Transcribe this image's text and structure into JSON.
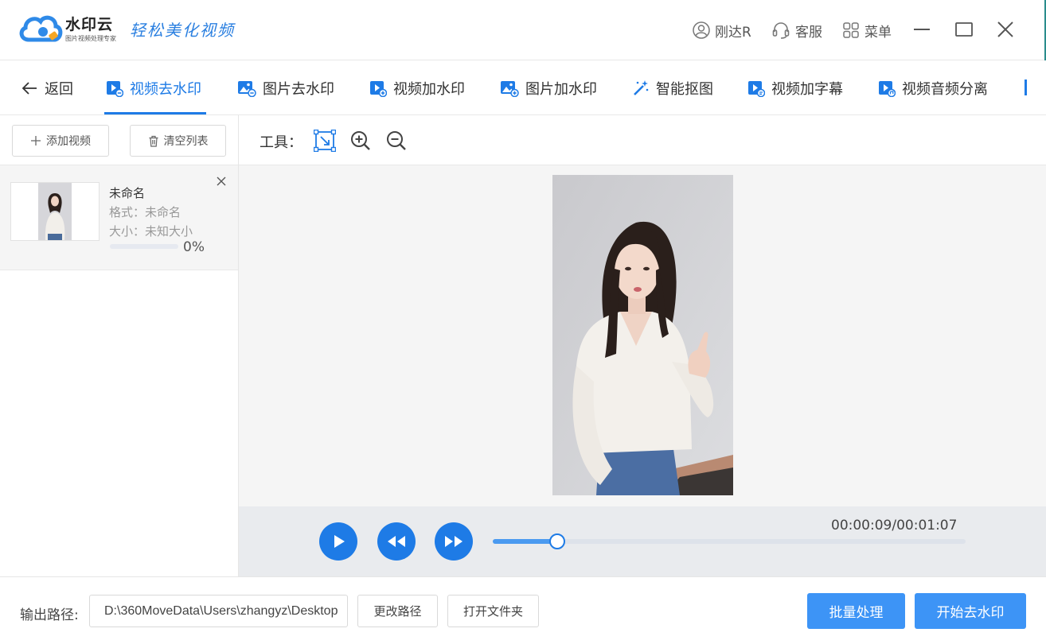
{
  "app": {
    "brand": "水印云",
    "brand_sub": "图片视频处理专家",
    "slogan": "轻松美化视频"
  },
  "titlebar": {
    "user": "刚达R",
    "service": "客服",
    "menu": "菜单"
  },
  "tabs": {
    "back": "返回",
    "items": [
      "视频去水印",
      "图片去水印",
      "视频加水印",
      "图片加水印",
      "智能抠图",
      "视频加字幕",
      "视频音频分离"
    ],
    "active": "视频去水印"
  },
  "left": {
    "add_video": "添加视频",
    "clear_list": "清空列表",
    "file": {
      "name": "未命名",
      "format": "格式：未命名",
      "size": "大小：未知大小",
      "progress_text": "0%",
      "progress": 0
    }
  },
  "tools": {
    "label": "工具："
  },
  "player": {
    "time": "00:00:09/00:01:07",
    "position": 0.136
  },
  "bottom": {
    "output_label": "输出路径:",
    "output_path": "D:\\360MoveData\\Users\\zhangyz\\Desktop",
    "change_path": "更改路径",
    "open_folder": "打开文件夹",
    "batch": "批量处理",
    "start": "开始去水印"
  },
  "colors": {
    "accent": "#1e7be6",
    "primary_button": "#3d94f6"
  }
}
